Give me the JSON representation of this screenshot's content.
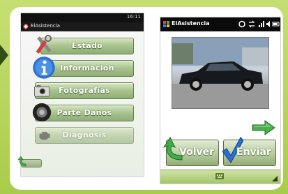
{
  "screen_left": {
    "status_time": "16:11",
    "app_title": "ElAsistencia",
    "menu": [
      {
        "label": "Estado",
        "icon": "tools-icon"
      },
      {
        "label": "Información",
        "icon": "info-icon"
      },
      {
        "label": "Fotografías",
        "icon": "camera-icon"
      },
      {
        "label": "Parte Daños",
        "icon": "tire-icon"
      },
      {
        "label": "Diagnosis",
        "icon": "engine-icon"
      }
    ],
    "home_button": {
      "label": "",
      "icon": "back-arrow-icon"
    }
  },
  "screen_right": {
    "app_title": "ElAsistencia",
    "photo_subject": "car-photo",
    "buttons": {
      "back_label": "Volver",
      "send_label": "Enviar"
    }
  },
  "colors": {
    "frame_green": "#b2d25a",
    "button_green": "#a8c28d",
    "arrow_green": "#47b04b"
  }
}
